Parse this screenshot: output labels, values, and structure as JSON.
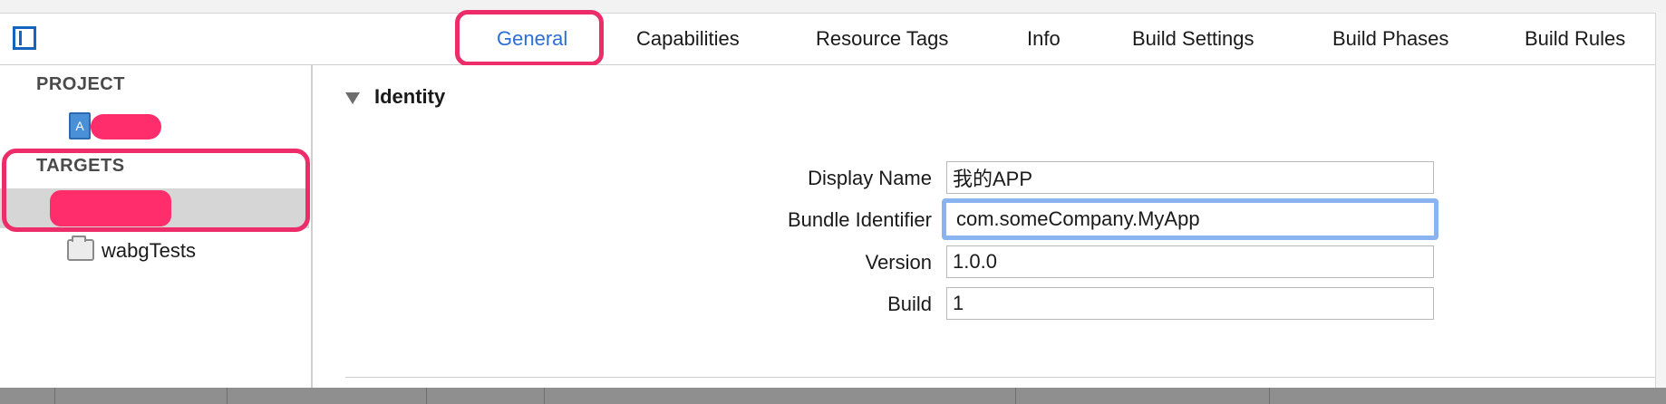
{
  "tabs": [
    {
      "label": "General",
      "active": true
    },
    {
      "label": "Capabilities",
      "active": false
    },
    {
      "label": "Resource Tags",
      "active": false
    },
    {
      "label": "Info",
      "active": false
    },
    {
      "label": "Build Settings",
      "active": false
    },
    {
      "label": "Build Phases",
      "active": false
    },
    {
      "label": "Build Rules",
      "active": false
    }
  ],
  "sidebar": {
    "project_header": "PROJECT",
    "targets_header": "TARGETS",
    "test_target_label": "wabgTests"
  },
  "identity": {
    "section_title": "Identity",
    "fields": [
      {
        "label": "Display Name",
        "value": "我的APP"
      },
      {
        "label": "Bundle Identifier",
        "value": "com.someCompany.MyApp"
      },
      {
        "label": "Version",
        "value": "1.0.0"
      },
      {
        "label": "Build",
        "value": "1"
      }
    ]
  },
  "colors": {
    "accent": "#2a6fd6",
    "highlight": "#ec2d6a",
    "redaction": "#ff2d6b",
    "focus_ring": "#8ab4f0"
  },
  "icons": {
    "sidebar_toggle": "sidebar-toggle-icon",
    "project": "app-project-icon",
    "test_target": "folder-icon",
    "disclosure": "disclosure-triangle-icon"
  }
}
